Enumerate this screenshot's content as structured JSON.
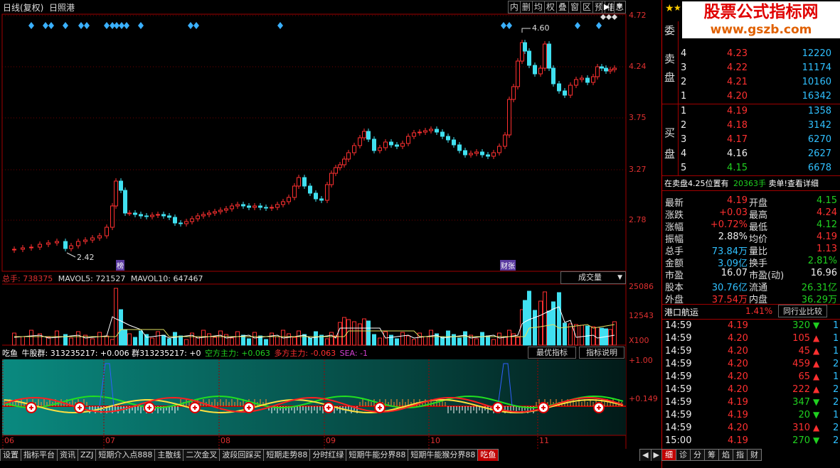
{
  "header": {
    "period": "日线(复权)",
    "stock": "日照港",
    "buttons": [
      "内",
      "删",
      "均",
      "权",
      "叠",
      "窗",
      "区",
      "预",
      "信息"
    ]
  },
  "price_axis": [
    "4.72",
    "4.24",
    "3.75",
    "3.27",
    "2.78"
  ],
  "annotations": {
    "high": "4.60",
    "low": "2.42",
    "mark1": "榜",
    "mark2": "财张"
  },
  "volume": {
    "label": "总手: 738375",
    "mavol5": "MAVOL5: 721527",
    "mavol10": "MAVOL10: 647467",
    "dropdown": "成交量",
    "axis": [
      "25086",
      "12543",
      "X100"
    ]
  },
  "indicator": {
    "name": "吃鱼",
    "text1": "牛股群: 313235217: +0.006",
    "text2": "群313235217: +0",
    "kong": "空方主力: +0.063",
    "duo": "多方主力: -0.063",
    "sea": "SEA: -1",
    "btn1": "最优指标",
    "btn2": "指标说明",
    "axis": [
      "+1.00",
      "+0.149"
    ]
  },
  "months": [
    "06",
    "07",
    "08",
    "09",
    "10",
    "11"
  ],
  "bottom_tabs": [
    "设置",
    "指标平台",
    "资讯",
    "ZZJ",
    "短期介入点888",
    "主散线",
    "二次金叉",
    "波段回踩买",
    "短期走势88",
    "分时红绿",
    "短期牛能分界88",
    "短期牛能猴分界88",
    "吃鱼"
  ],
  "right_tabs": [
    "细",
    "诊",
    "分",
    "筹",
    "焰",
    "指",
    "财"
  ],
  "watermark": {
    "line1": "股票公式指标网",
    "line2": "www.gszb.com"
  },
  "orderbook": {
    "sell_label": [
      "委",
      "卖",
      "盘"
    ],
    "buy_label": [
      "买",
      "盘"
    ],
    "sells": [
      {
        "n": "4",
        "p": "4.23",
        "v": "12220"
      },
      {
        "n": "3",
        "p": "4.22",
        "v": "11174"
      },
      {
        "n": "2",
        "p": "4.21",
        "v": "10160"
      },
      {
        "n": "1",
        "p": "4.20",
        "v": "16342"
      }
    ],
    "buys": [
      {
        "n": "1",
        "p": "4.19",
        "v": "1358"
      },
      {
        "n": "2",
        "p": "4.18",
        "v": "3142"
      },
      {
        "n": "3",
        "p": "4.17",
        "v": "6270"
      },
      {
        "n": "4",
        "p": "4.16",
        "v": "2627"
      },
      {
        "n": "5",
        "p": "4.15",
        "v": "6678"
      }
    ]
  },
  "notice": {
    "a": "在卖盘4.25位置有",
    "b": "20363手",
    "c": "卖单!查看详细"
  },
  "stats": [
    {
      "l1": "最新",
      "v1": "4.19",
      "l2": "开盘",
      "v2": "4.15"
    },
    {
      "l1": "涨跌",
      "v1": "+0.03",
      "l2": "最高",
      "v2": "4.24"
    },
    {
      "l1": "涨幅",
      "v1": "+0.72%",
      "l2": "最低",
      "v2": "4.12"
    },
    {
      "l1": "振幅",
      "v1": "2.88%",
      "l2": "均价",
      "v2": "4.19"
    },
    {
      "l1": "总手",
      "v1": "73.84万",
      "l2": "量比",
      "v2": "1.13"
    },
    {
      "l1": "金额",
      "v1": "3.09亿",
      "l2": "换手",
      "v2": "2.81%"
    },
    {
      "l1": "市盈",
      "v1": "16.07",
      "l2": "市盈(动)",
      "v2": "16.96"
    },
    {
      "l1": "股本",
      "v1": "30.76亿",
      "l2": "流通",
      "v2": "26.31亿"
    },
    {
      "l1": "外盘",
      "v1": "37.54万",
      "l2": "内盘",
      "v2": "36.29万"
    }
  ],
  "industry": {
    "name": "港口航运",
    "pct": "1.41%",
    "btn": "同行业比较"
  },
  "ticks": [
    {
      "t": "14:59",
      "p": "4.19",
      "v": "320",
      "n": "1"
    },
    {
      "t": "14:59",
      "p": "4.20",
      "v": "105",
      "n": "1"
    },
    {
      "t": "14:59",
      "p": "4.20",
      "v": "45",
      "n": "1"
    },
    {
      "t": "14:59",
      "p": "4.20",
      "v": "459",
      "n": "2"
    },
    {
      "t": "14:59",
      "p": "4.20",
      "v": "65",
      "n": "1"
    },
    {
      "t": "14:59",
      "p": "4.20",
      "v": "222",
      "n": "2"
    },
    {
      "t": "14:59",
      "p": "4.19",
      "v": "347",
      "n": "2"
    },
    {
      "t": "14:59",
      "p": "4.19",
      "v": "20",
      "n": "1"
    },
    {
      "t": "14:59",
      "p": "4.20",
      "v": "310",
      "n": "2"
    },
    {
      "t": "15:00",
      "p": "4.19",
      "v": "270",
      "n": "2"
    }
  ]
}
